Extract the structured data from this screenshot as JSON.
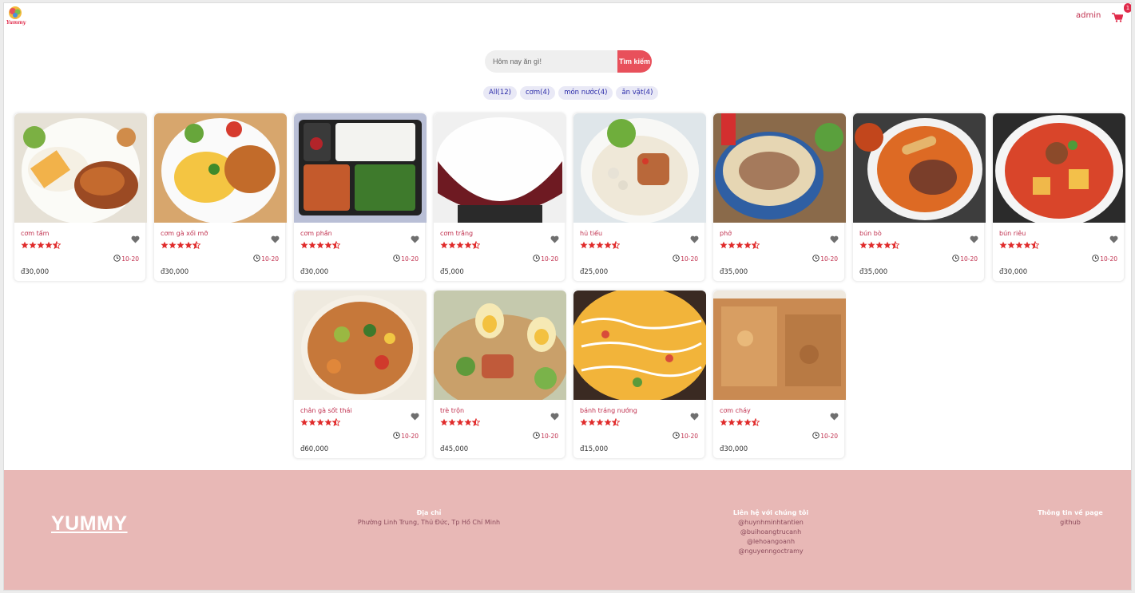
{
  "header": {
    "logo_text": "Yummy",
    "user": "admin",
    "cart_count": "1"
  },
  "search": {
    "placeholder": "Hôm nay ăn gì!",
    "button": "Tìm kiếm"
  },
  "filters": [
    "All(12)",
    "cơm(4)",
    "món nước(4)",
    "ăn vặt(4)"
  ],
  "products": [
    {
      "name": "cơm tấm",
      "price": "đ30,000",
      "time": "10-20",
      "rating": 4.5,
      "image": "com-tam"
    },
    {
      "name": "cơm gà xối mỡ",
      "price": "đ30,000",
      "time": "10-20",
      "rating": 4.5,
      "image": "com-ga"
    },
    {
      "name": "cơm phần",
      "price": "đ30,000",
      "time": "10-20",
      "rating": 4.5,
      "image": "com-phan"
    },
    {
      "name": "cơm trắng",
      "price": "đ5,000",
      "time": "10-20",
      "rating": 4.5,
      "image": "com-trang"
    },
    {
      "name": "hủ tiếu",
      "price": "đ25,000",
      "time": "10-20",
      "rating": 4.5,
      "image": "hu-tieu"
    },
    {
      "name": "phở",
      "price": "đ35,000",
      "time": "10-20",
      "rating": 4.5,
      "image": "pho"
    },
    {
      "name": "bún bò",
      "price": "đ35,000",
      "time": "10-20",
      "rating": 4.5,
      "image": "bun-bo"
    },
    {
      "name": "bún riêu",
      "price": "đ30,000",
      "time": "10-20",
      "rating": 4.5,
      "image": "bun-rieu"
    },
    {
      "name": "chân gà sốt thái",
      "price": "đ60,000",
      "time": "10-20",
      "rating": 4.5,
      "image": "chan-ga"
    },
    {
      "name": "trè trộn",
      "price": "đ45,000",
      "time": "10-20",
      "rating": 4.5,
      "image": "tre-tron"
    },
    {
      "name": "bánh tráng nướng",
      "price": "đ15,000",
      "time": "10-20",
      "rating": 4.5,
      "image": "banh-trang"
    },
    {
      "name": "cơm cháy",
      "price": "đ30,000",
      "time": "10-20",
      "rating": 4.5,
      "image": "com-chay"
    }
  ],
  "footer": {
    "brand": "YUMMY",
    "address_title": "Địa chỉ",
    "address": "Phường Linh Trung, Thủ Đức, Tp Hồ Chí Minh",
    "contact_title": "Liên hệ với chúng tôi",
    "contacts": [
      "@huynhminhtantien",
      "@buihoangtrucanh",
      "@lehoangoanh",
      "@nguyenngoctramy"
    ],
    "page_title": "Thông tin về page",
    "page_link": "github"
  },
  "colors": {
    "accent": "#e8505b",
    "name_text": "#c0304e",
    "footer_bg": "#e8b8b6",
    "chip_bg": "#e9e9f6",
    "chip_text": "#2a2aa8"
  }
}
